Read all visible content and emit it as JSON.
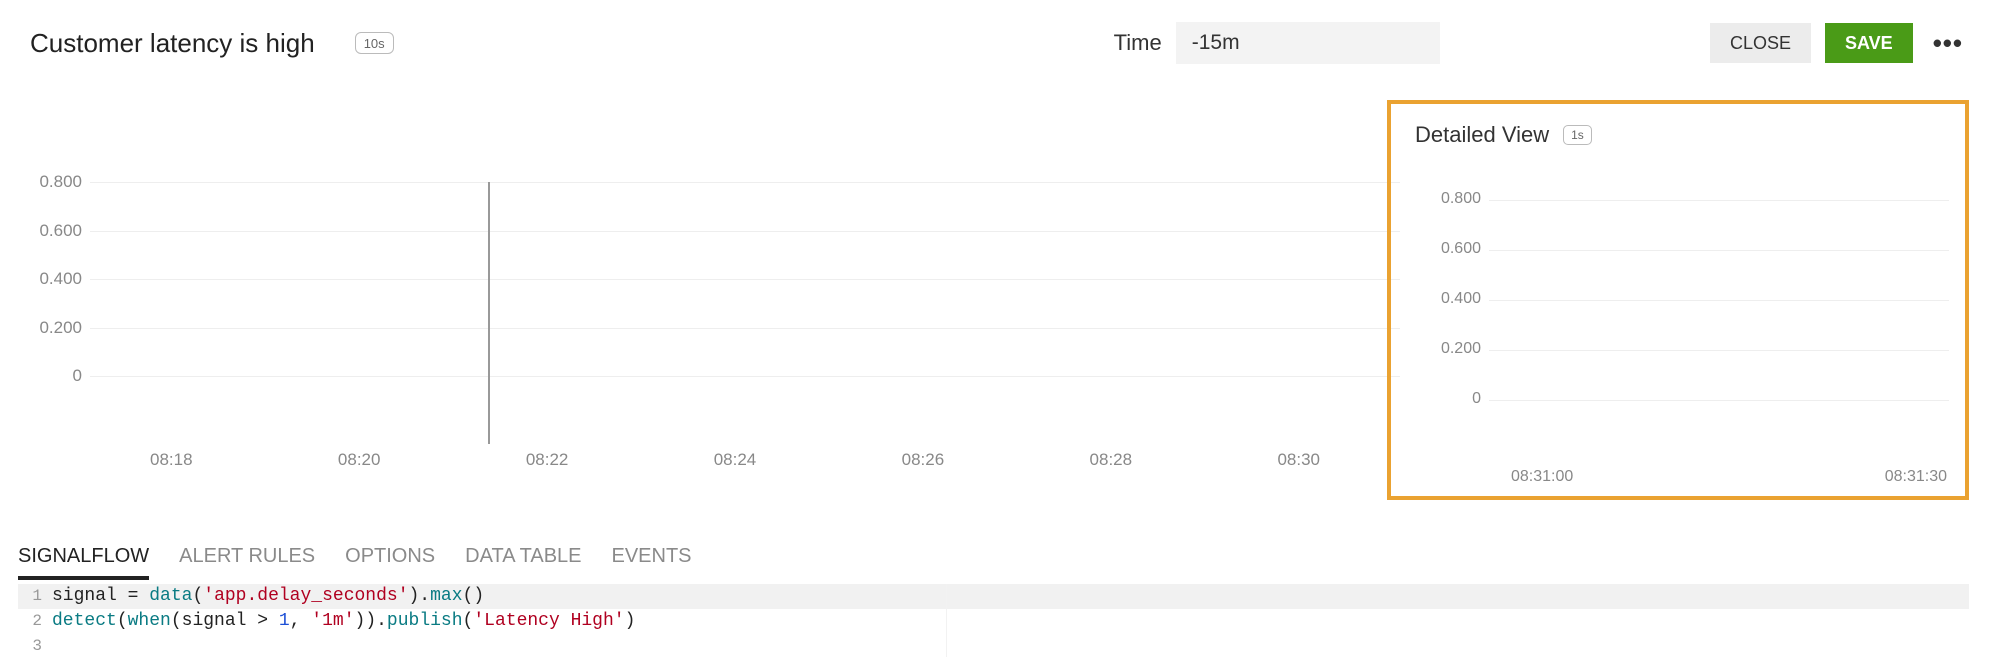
{
  "header": {
    "title": "Customer latency is high",
    "interval_pill": "10s",
    "time_label": "Time",
    "time_value": "-15m",
    "close_label": "CLOSE",
    "save_label": "SAVE"
  },
  "main_chart": {
    "y_ticks": [
      "0.800",
      "0.600",
      "0.400",
      "0.200",
      "0"
    ],
    "x_ticks": [
      "08:18",
      "08:20",
      "08:22",
      "08:24",
      "08:26",
      "08:28",
      "08:30"
    ]
  },
  "detail": {
    "title": "Detailed View",
    "interval_pill": "1s",
    "y_ticks": [
      "0.800",
      "0.600",
      "0.400",
      "0.200",
      "0"
    ],
    "x_ticks": [
      "08:31:00",
      "08:31:30"
    ]
  },
  "tabs": [
    "SIGNALFLOW",
    "ALERT RULES",
    "OPTIONS",
    "DATA TABLE",
    "EVENTS"
  ],
  "active_tab_index": 0,
  "code": {
    "lines": [
      {
        "n": "1",
        "parts": [
          {
            "t": "plain",
            "v": "signal "
          },
          {
            "t": "plain",
            "v": "= "
          },
          {
            "t": "call",
            "v": "data"
          },
          {
            "t": "plain",
            "v": "("
          },
          {
            "t": "str",
            "v": "'app.delay_seconds'"
          },
          {
            "t": "plain",
            "v": ")."
          },
          {
            "t": "call",
            "v": "max"
          },
          {
            "t": "plain",
            "v": "()"
          }
        ]
      },
      {
        "n": "2",
        "parts": [
          {
            "t": "call",
            "v": "detect"
          },
          {
            "t": "plain",
            "v": "("
          },
          {
            "t": "call",
            "v": "when"
          },
          {
            "t": "plain",
            "v": "(signal > "
          },
          {
            "t": "num",
            "v": "1"
          },
          {
            "t": "plain",
            "v": ", "
          },
          {
            "t": "str",
            "v": "'1m'"
          },
          {
            "t": "plain",
            "v": "))."
          },
          {
            "t": "call",
            "v": "publish"
          },
          {
            "t": "plain",
            "v": "("
          },
          {
            "t": "str",
            "v": "'Latency High'"
          },
          {
            "t": "plain",
            "v": ")"
          }
        ]
      },
      {
        "n": "3",
        "parts": []
      }
    ]
  },
  "chart_data": [
    {
      "type": "line",
      "title": "Customer latency is high",
      "ylim": [
        0,
        1.0
      ],
      "y_ticks": [
        0,
        0.2,
        0.4,
        0.6,
        0.8
      ],
      "x_ticks": [
        "08:18",
        "08:20",
        "08:22",
        "08:24",
        "08:26",
        "08:28",
        "08:30"
      ],
      "series": [],
      "cursor_x": "08:21"
    },
    {
      "type": "line",
      "title": "Detailed View",
      "ylim": [
        0,
        1.0
      ],
      "y_ticks": [
        0,
        0.2,
        0.4,
        0.6,
        0.8
      ],
      "x_ticks": [
        "08:31:00",
        "08:31:30"
      ],
      "series": []
    }
  ]
}
